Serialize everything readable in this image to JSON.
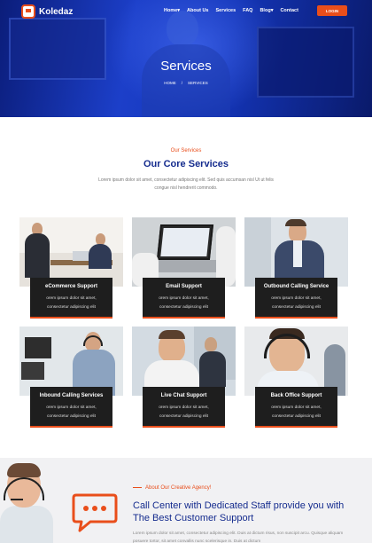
{
  "brand": {
    "name": "Koledaz"
  },
  "nav": {
    "items": [
      "Home",
      "About Us",
      "Services",
      "FAQ",
      "Blog",
      "Contact"
    ],
    "dropdown_marks": [
      "▾",
      "",
      "",
      "",
      "▾",
      ""
    ],
    "login_label": "LOGIN"
  },
  "hero": {
    "title": "Services",
    "breadcrumb": [
      "HOME",
      "/",
      "SERVICES"
    ]
  },
  "services": {
    "tag": "Our Services",
    "title": "Our Core Services",
    "description": "Lorem ipsum dolor sit amet, consectetur adipiscing elit. Sed quis accumsan nisl Ut ut felis congue nisl hendrerit commodo.",
    "cards": [
      {
        "title": "eCommerce Support",
        "line1": "orem ipsum dolor sit amet,",
        "line2": "consectetur adipiscing elit"
      },
      {
        "title": "Email Support",
        "line1": "orem ipsum dolor sit amet,",
        "line2": "consectetur adipiscing elit"
      },
      {
        "title": "Outbound Calling Service",
        "line1": "orem ipsum dolor sit amet,",
        "line2": "consectetur adipiscing elit"
      },
      {
        "title": "Inbound Calling Services",
        "line1": "orem ipsum dolor sit amet,",
        "line2": "consectetur adipiscing elit"
      },
      {
        "title": "Live Chat Support",
        "line1": "orem ipsum dolor sit amet,",
        "line2": "consectetur adipiscing elit"
      },
      {
        "title": "Back Office Support",
        "line1": "orem ipsum dolor sit amet,",
        "line2": "consectetur adipiscing elit"
      }
    ]
  },
  "about": {
    "tag": "About Our Creative Agency!",
    "title": "Call Center with Dedicated Staff provide you with The Best Customer Support",
    "text": "Lorem ipsum dolor sit amet, consectetur adipiscing elit. Duis at dictum risus, non suscipit arcu. Quisque aliquam posuere tortor, sit amet convallis nunc scelerisque in. Duis at dictum"
  },
  "colors": {
    "accent": "#e94e1b",
    "navy": "#152c8e",
    "card_bg": "#1e1e1e"
  },
  "icons": [
    "logo-chat-icon",
    "chat-bubble-icon",
    "chevron-down-icon"
  ]
}
